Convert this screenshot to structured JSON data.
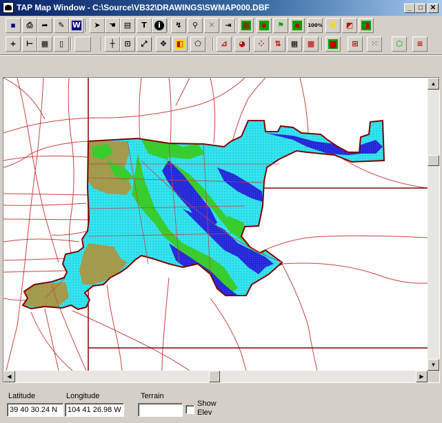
{
  "window": {
    "title": "TAP Map Window - C:\\Source\\VB32\\DRAWINGS\\SWMAP000.DBF",
    "controls": {
      "minimize": "_",
      "maximize": "□",
      "close": "✕"
    }
  },
  "toolbar_row1": [
    {
      "name": "save-icon",
      "glyph": "▪",
      "color": "#000080"
    },
    {
      "name": "print-icon",
      "glyph": "⎙",
      "color": "#000"
    },
    {
      "name": "arrow-forward-icon",
      "glyph": "➦",
      "color": "#000"
    },
    {
      "name": "edit-form-icon",
      "glyph": "✎",
      "color": "#000"
    },
    {
      "name": "w-logo-icon",
      "glyph": "W",
      "color": "#fff",
      "bg": "#000080"
    },
    {
      "name": "pointer-icon",
      "glyph": "➤",
      "color": "#000"
    },
    {
      "name": "pan-hand-icon",
      "glyph": "☚",
      "color": "#000"
    },
    {
      "name": "copy-table-icon",
      "glyph": "▤",
      "color": "#000"
    },
    {
      "name": "text-tool-icon",
      "glyph": "T",
      "color": "#000"
    },
    {
      "name": "info-icon",
      "glyph": "i",
      "color": "#fff",
      "bg": "#000",
      "round": true
    },
    {
      "name": "route-icon",
      "glyph": "↯",
      "color": "#000"
    },
    {
      "name": "find-icon",
      "glyph": "⚲",
      "color": "#000"
    },
    {
      "name": "delete-icon",
      "glyph": "✕",
      "color": "#808080"
    },
    {
      "name": "exit-icon",
      "glyph": "⇥",
      "color": "#000"
    },
    {
      "name": "zoom-select-icon",
      "glyph": "▦",
      "color": "#c00000",
      "bg": "#00a000"
    },
    {
      "name": "small-node-icon",
      "glyph": "▪",
      "color": "#c00000",
      "bg": "#00a000"
    },
    {
      "name": "pin-tool-icon",
      "glyph": "⚑",
      "color": "#00a000"
    },
    {
      "name": "red-region-icon",
      "glyph": "▪",
      "color": "#c00000",
      "bg": "#00a000"
    },
    {
      "name": "zoom-100-icon",
      "glyph": "100%",
      "color": "#000"
    },
    {
      "name": "yellow-layer-icon",
      "glyph": "R",
      "color": "#ffd700"
    },
    {
      "name": "red-layer-icon",
      "glyph": "◩",
      "color": "#c00000"
    },
    {
      "name": "layer-stack-icon",
      "glyph": "◨",
      "color": "#c00000",
      "bg": "#00a000"
    }
  ],
  "toolbar_row2": [
    {
      "name": "plus-icon",
      "glyph": "+",
      "color": "#000"
    },
    {
      "name": "scale-bar-icon",
      "glyph": "⊢",
      "color": "#000"
    },
    {
      "name": "grid-icon",
      "glyph": "▦",
      "color": "#000"
    },
    {
      "name": "page-icon",
      "glyph": "▯",
      "color": "#000"
    },
    {
      "name": "blank-button",
      "glyph": "",
      "color": "#000",
      "wide": true
    },
    {
      "name": "crosshair-select-icon",
      "glyph": "┼",
      "color": "#000"
    },
    {
      "name": "zoom-box-icon",
      "glyph": "⊡",
      "color": "#000"
    },
    {
      "name": "resize-icon",
      "glyph": "⤢",
      "color": "#000"
    },
    {
      "name": "move-cross-icon",
      "glyph": "✥",
      "color": "#000"
    },
    {
      "name": "color-fill-icon",
      "glyph": "◧",
      "color": "#c00000",
      "bg": "#ffd700"
    },
    {
      "name": "polygon-icon",
      "glyph": "⬠",
      "color": "#000"
    },
    {
      "name": "line-chart-icon",
      "glyph": "⊿",
      "color": "#c00000"
    },
    {
      "name": "pie-chart-icon",
      "glyph": "◕",
      "color": "#c00000"
    },
    {
      "name": "scatter-points-icon",
      "glyph": "⁘",
      "color": "#c00000"
    },
    {
      "name": "red-arrows-icon",
      "glyph": "⇅",
      "color": "#c00000"
    },
    {
      "name": "table-grid-icon",
      "glyph": "▦",
      "color": "#000"
    },
    {
      "name": "color-grid-icon",
      "glyph": "▩",
      "color": "#c00000"
    },
    {
      "name": "histogram-icon",
      "glyph": "▆",
      "color": "#c00000",
      "bg": "#00a000"
    },
    {
      "name": "network-icon",
      "glyph": "⊞",
      "color": "#c00000"
    },
    {
      "name": "dot-grid-icon",
      "glyph": "⁙",
      "color": "#808080"
    },
    {
      "name": "green-polygon-icon",
      "glyph": "⬡",
      "color": "#00a000"
    },
    {
      "name": "legend-icon",
      "glyph": "≡",
      "color": "#c00000"
    }
  ],
  "status": {
    "latitude_label": "Latitude",
    "latitude_value": "39 40 30.24 N",
    "longitude_label": "Longitude",
    "longitude_value": "104 41 26.98 W",
    "terrain_label": "Terrain",
    "terrain_value": "",
    "show_elev_label_1": "Show",
    "show_elev_label_2": "Elev"
  },
  "colors": {
    "region_cyan": "#33e5f0",
    "region_green": "#39cc2e",
    "region_olive": "#a8a050",
    "region_blue": "#1f24d8",
    "boundary": "#800000",
    "road": "#c84040"
  }
}
